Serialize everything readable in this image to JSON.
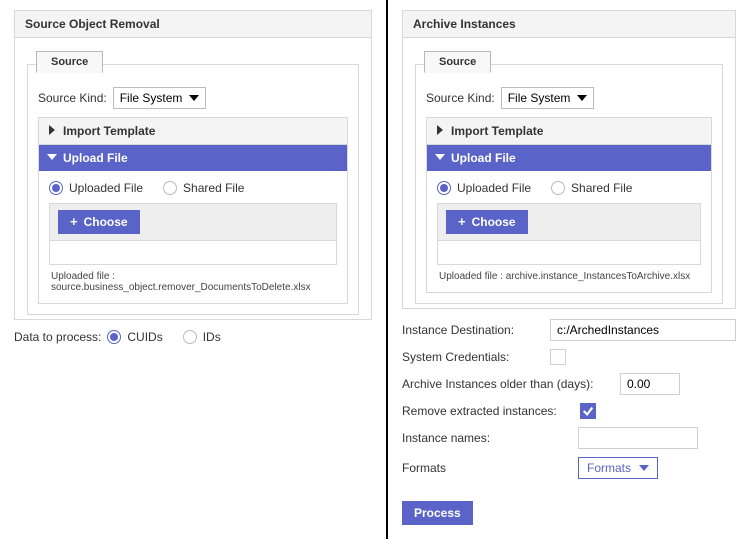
{
  "left": {
    "title": "Source Object Removal",
    "source_tab": "Source",
    "source_kind_label": "Source Kind:",
    "source_kind_value": "File System",
    "acc_import": "Import Template",
    "acc_upload": "Upload File",
    "radio_uploaded": "Uploaded File",
    "radio_shared": "Shared File",
    "choose": "Choose",
    "uploaded_line": "Uploaded file : source.business_object.remover_DocumentsToDelete.xlsx",
    "data_process_label": "Data to process:",
    "opt_cuids": "CUIDs",
    "opt_ids": "IDs"
  },
  "right": {
    "title": "Archive Instances",
    "source_tab": "Source",
    "source_kind_label": "Source Kind:",
    "source_kind_value": "File System",
    "acc_import": "Import Template",
    "acc_upload": "Upload File",
    "radio_uploaded": "Uploaded File",
    "radio_shared": "Shared File",
    "choose": "Choose",
    "uploaded_line": "Uploaded file : archive.instance_InstancesToArchive.xlsx",
    "dest_label": "Instance Destination:",
    "dest_value": "c:/ArchedInstances",
    "syscred_label": "System Credentials:",
    "older_label": "Archive Instances older than (days):",
    "older_value": "0.00",
    "remove_label": "Remove extracted instances:",
    "names_label": "Instance names:",
    "names_value": "",
    "formats_label": "Formats",
    "formats_value": "Formats",
    "process": "Process"
  }
}
